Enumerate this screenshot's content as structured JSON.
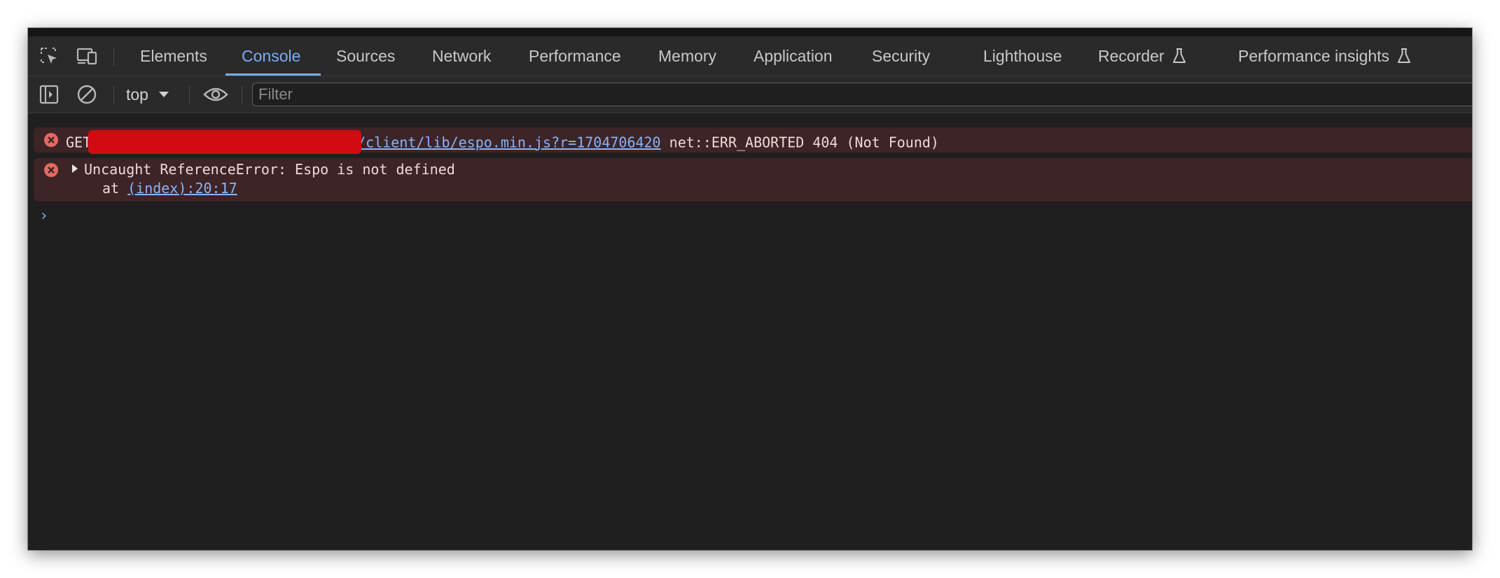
{
  "tabs": [
    {
      "label": "Elements",
      "active": false
    },
    {
      "label": "Console",
      "active": true
    },
    {
      "label": "Sources",
      "active": false
    },
    {
      "label": "Network",
      "active": false
    },
    {
      "label": "Performance",
      "active": false
    },
    {
      "label": "Memory",
      "active": false
    },
    {
      "label": "Application",
      "active": false
    },
    {
      "label": "Security",
      "active": false
    },
    {
      "label": "Lighthouse",
      "active": false
    },
    {
      "label": "Recorder",
      "active": false,
      "icon": "flask-icon"
    },
    {
      "label": "Performance insights",
      "active": false,
      "icon": "flask-icon"
    }
  ],
  "toolbar": {
    "context": "top",
    "filter_placeholder": "Filter"
  },
  "messages": [
    {
      "level": "error",
      "method": "GET",
      "url": "/client/lib/espo.min.js?r=1704706420",
      "status": "net::ERR_ABORTED 404 (Not Found)"
    },
    {
      "level": "error",
      "text": "Uncaught ReferenceError: Espo is not defined",
      "at_prefix": "at",
      "location": "(index):20:17"
    }
  ],
  "colors": {
    "accent": "#7cacf8",
    "error_bg": "#3d2427",
    "error_icon": "#e46962",
    "redaction": "#d10b11",
    "panel_bg": "#1f1f1f",
    "toolbar_bg": "#2a2a2a"
  }
}
